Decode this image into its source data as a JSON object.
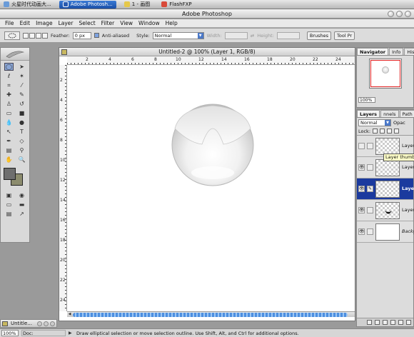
{
  "taskbar": {
    "items": [
      {
        "label": "火星时代动画大...",
        "active": false,
        "icon": "window-icon"
      },
      {
        "label": "Adobe Photosh...",
        "active": true,
        "icon": "photoshop-icon"
      },
      {
        "label": "1 - 画图",
        "active": false,
        "icon": "paint-icon"
      },
      {
        "label": "FlashFXP",
        "active": false,
        "icon": "flashfxp-icon"
      }
    ]
  },
  "app": {
    "title": "Adobe Photoshop"
  },
  "menu": [
    "File",
    "Edit",
    "Image",
    "Layer",
    "Select",
    "Filter",
    "View",
    "Window",
    "Help"
  ],
  "options": {
    "feather_label": "Feather:",
    "feather_value": "0 px",
    "antialiased_label": "Anti-aliased",
    "style_label": "Style:",
    "style_value": "Normal",
    "width_label": "Width:",
    "height_label": "Height:",
    "tabs": [
      "Brushes",
      "Tool Pr"
    ]
  },
  "document": {
    "title": "Untitled-2 @ 100% (Layer 1, RGB/8)",
    "ruler_top": [
      "2",
      "4",
      "6",
      "8",
      "10",
      "12",
      "14",
      "16",
      "18",
      "20",
      "22",
      "24"
    ],
    "ruler_left": [
      "2",
      "4",
      "6",
      "8",
      "10",
      "12",
      "14",
      "16",
      "18",
      "20",
      "22",
      "24"
    ]
  },
  "navigator": {
    "tabs": [
      "Navigator",
      "Info",
      "Histo"
    ],
    "zoom": "100%"
  },
  "layers": {
    "tabs": [
      "Layers",
      "nnels",
      "Path",
      "ory"
    ],
    "blend_mode": "Normal",
    "opacity_label": "Opac",
    "lock_label": "Lock:",
    "tooltip": "Layer thumb",
    "rows": [
      {
        "name": "Layer",
        "visible": false,
        "selected": false,
        "thumb": "transparent"
      },
      {
        "name": "Layer",
        "visible": true,
        "selected": false,
        "thumb": "transparent"
      },
      {
        "name": "Layer",
        "visible": true,
        "selected": true,
        "thumb": "transparent"
      },
      {
        "name": "Layer",
        "visible": true,
        "selected": false,
        "thumb": "shape"
      },
      {
        "name": "Backg",
        "visible": true,
        "selected": false,
        "thumb": "white"
      }
    ]
  },
  "minimized": {
    "label": "Untitle..."
  },
  "status": {
    "zoom": "100%",
    "doc": "Doc: 1.37M/3.34M",
    "hint": "Draw elliptical selection or move selection outline.  Use Shift, Alt, and Ctrl for additional options."
  },
  "colors": {
    "foreground": "#6e6e6e",
    "background": "#8c8c6e",
    "selection_highlight": "#1b3a9e",
    "scroll_accent": "#4d8fe0"
  }
}
